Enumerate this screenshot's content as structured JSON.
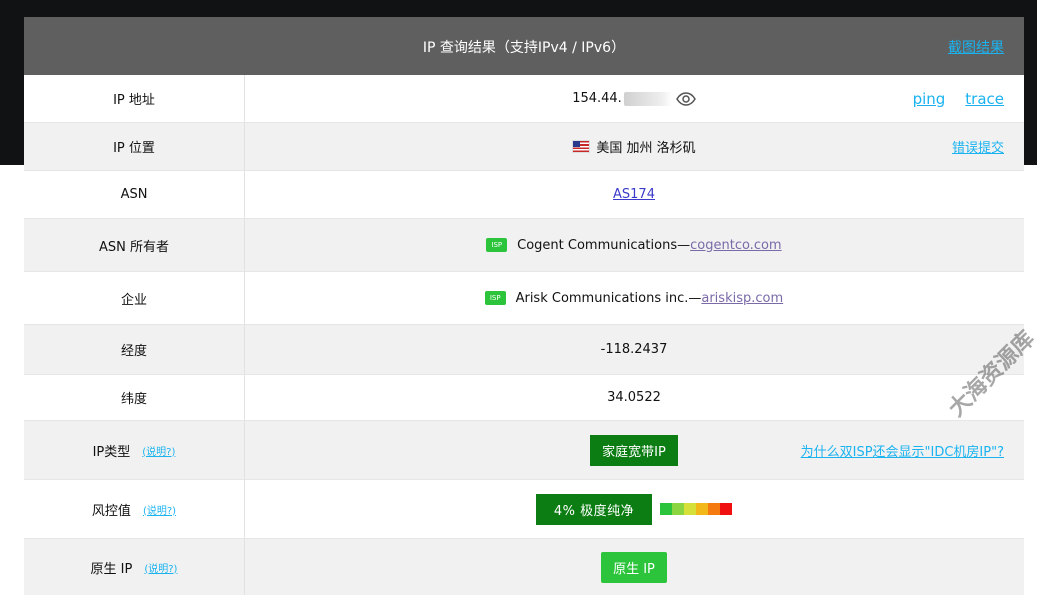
{
  "header": {
    "title": "IP 查询结果（支持IPv4 / IPv6）",
    "screenshot_link": "截图结果"
  },
  "rows": {
    "ip": {
      "label": "IP 地址",
      "value": "154.44.",
      "ping": "ping",
      "trace": "trace"
    },
    "location": {
      "label": "IP 位置",
      "value": "美国 加州 洛杉矶",
      "report": "错误提交"
    },
    "asn": {
      "label": "ASN",
      "value": "AS174"
    },
    "asn_owner": {
      "label": "ASN 所有者",
      "badge": "ISP",
      "name": "Cogent Communications—",
      "domain": "cogentco.com"
    },
    "company": {
      "label": "企业",
      "badge": "ISP",
      "name": "Arisk Communications inc.—",
      "domain": "ariskisp.com"
    },
    "longitude": {
      "label": "经度",
      "value": "-118.2437"
    },
    "latitude": {
      "label": "纬度",
      "value": "34.0522"
    },
    "ip_type": {
      "label": "IP类型",
      "note": "(说明?)",
      "value": "家庭宽带IP",
      "faq": "为什么双ISP还会显示\"IDC机房IP\"?"
    },
    "risk": {
      "label": "风控值",
      "note": "(说明?)",
      "value": "4%  极度纯净",
      "level_percent": 4,
      "bar_colors": [
        "#2bc43a",
        "#8bd640",
        "#d6e03a",
        "#f2b81a",
        "#f57a10",
        "#f01010"
      ]
    },
    "native": {
      "label": "原生 IP",
      "note": "(说明?)",
      "value": "原生 IP"
    }
  },
  "watermark": "大海资源库",
  "colors": {
    "header_bg": "#5f5f5f",
    "link": "#1ab3f0",
    "green_dark": "#0b7d12",
    "green_light": "#2bc43a"
  }
}
